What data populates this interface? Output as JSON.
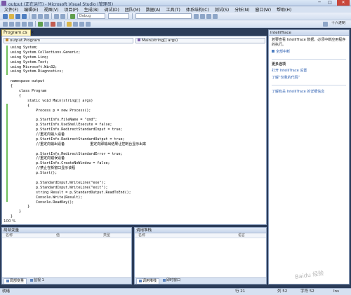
{
  "window": {
    "title": "output (正在运行) - Microsoft Visual Studio (管理员)",
    "minimize": "─",
    "maximize": "□",
    "close": "✕"
  },
  "menu": [
    "文件(F)",
    "编辑(E)",
    "视图(V)",
    "项目(P)",
    "生成(B)",
    "调试(D)",
    "团队(M)",
    "数据(A)",
    "工具(T)",
    "体系结构(C)",
    "测试(S)",
    "分析(N)",
    "窗口(W)",
    "帮助(H)"
  ],
  "toolbar": {
    "config": "Debug",
    "hex_label": "十六进制"
  },
  "editor": {
    "tab_label": "Program.cs",
    "tab_close": "×",
    "nav_left": "output.Program",
    "nav_right": "Main(string[] args)",
    "zoom": "100 %",
    "code": [
      "using System;",
      "using System.Collections.Generic;",
      "using System.Linq;",
      "using System.Text;",
      "using Microsoft.Win32;",
      "using System.Diagnostics;",
      "",
      "namespace output",
      "{",
      "    class Program",
      "    {",
      "        static void Main(string[] args)",
      "        {",
      "            Process p = new Process();",
      "",
      "            p.StartInfo.FileName = \"cmd\";",
      "            p.StartInfo.UseShellExecute = false;",
      "            p.StartInfo.RedirectStandardInput = true;",
      "            //重定向输入设备",
      "            p.StartInfo.RedirectStandardOutput = true;",
      "            //重定向输出设备            重定向即输出结果让控制台显示出来",
      "",
      "            p.StartInfo.RedirectStandardError = true;",
      "            //重定向错误设备",
      "            p.StartInfo.CreateNoWindow = false;",
      "            //禁止在新窗口显示该程",
      "            p.Start();",
      "",
      "            p.StandardInput.WriteLine(\"exe\");",
      "            p.StandardInput.WriteLine(\"exit\");",
      "            string Result = p.StandardOutput.ReadToEnd();",
      "            Console.Write(Result);",
      "            Console.ReadKey();",
      "        }",
      "    }",
      "}"
    ]
  },
  "locals_panel": {
    "title": "局部变量",
    "columns": [
      "名称",
      "值",
      "类型"
    ],
    "tabs": [
      "局部变量",
      "监视 1"
    ]
  },
  "callstack_panel": {
    "title": "调用堆栈",
    "columns": [
      "名称",
      "语言"
    ],
    "tabs": [
      "调用堆栈",
      "即时窗口"
    ]
  },
  "intellitrace": {
    "title": "IntelliTrace",
    "intro": "若要查看 IntelliTrace 数据，必须中断应用程序的执行。",
    "break_all": "全部中断",
    "more_header": "更多选项",
    "open_settings": "打开 IntelliTrace 设置",
    "learn_more": "了解“仅我的代码”",
    "about": "了解有关 IntelliTrace 的详细信息"
  },
  "statusbar": {
    "ready": "就绪",
    "line": "行 21",
    "col": "列 52",
    "ch": "字符 52",
    "ins": "Ins"
  },
  "watermark": "Baidu 经验",
  "colors": {
    "accent": "#2b3c59",
    "link": "#2a5db0",
    "tab_active": "#fdf5c7"
  }
}
